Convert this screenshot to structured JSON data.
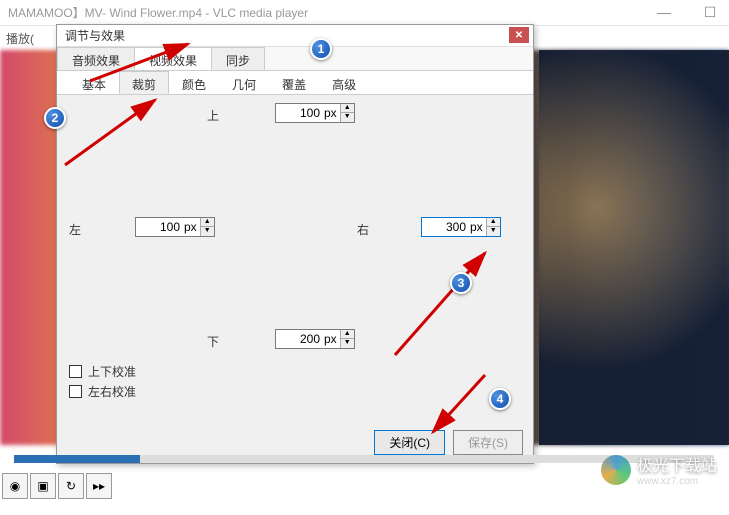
{
  "main": {
    "title": "MAMAMOO】MV- Wind Flower.mp4 - VLC media player",
    "menu": {
      "play": "播放("
    }
  },
  "dialog": {
    "title": "调节与效果",
    "top_tabs": {
      "audio": "音频效果",
      "video": "视频效果",
      "sync": "同步"
    },
    "sub_tabs": {
      "basic": "基本",
      "crop": "裁剪",
      "color": "颜色",
      "geometry": "几何",
      "overlay": "覆盖",
      "advanced": "高级"
    },
    "crop": {
      "top_label": "上",
      "top_value": "100",
      "left_label": "左",
      "left_value": "100",
      "right_label": "右",
      "right_value": "300",
      "bottom_label": "下",
      "bottom_value": "200",
      "unit": "px",
      "sync_tb": "上下校准",
      "sync_lr": "左右校准"
    },
    "buttons": {
      "close": "关闭(C)",
      "save": "保存(S)"
    }
  },
  "annotations": {
    "n1": "1",
    "n2": "2",
    "n3": "3",
    "n4": "4"
  },
  "watermark": {
    "name": "极光下载站",
    "url": "www.xz7.com"
  }
}
